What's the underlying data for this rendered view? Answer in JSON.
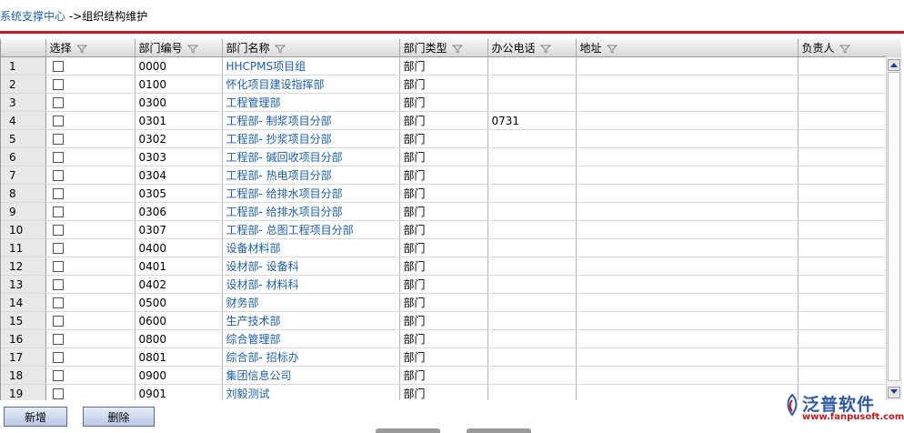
{
  "breadcrumb": {
    "root": "系统支撑中心",
    "separator": " ->",
    "current": "组织结构维护"
  },
  "columns": [
    "选择",
    "部门编号",
    "部门名称",
    "部门类型",
    "办公电话",
    "地址",
    "负责人"
  ],
  "rows": [
    {
      "n": "1",
      "code": "0000",
      "name": "HHCPMS项目组",
      "type": "部门",
      "phone": "",
      "addr": "",
      "owner": ""
    },
    {
      "n": "2",
      "code": "0100",
      "name": "怀化项目建设指挥部",
      "type": "部门",
      "phone": "",
      "addr": "",
      "owner": ""
    },
    {
      "n": "3",
      "code": "0300",
      "name": "工程管理部",
      "type": "部门",
      "phone": "",
      "addr": "",
      "owner": ""
    },
    {
      "n": "4",
      "code": "0301",
      "name": "工程部- 制浆项目分部",
      "type": "部门",
      "phone": "0731",
      "addr": "",
      "owner": ""
    },
    {
      "n": "5",
      "code": "0302",
      "name": "工程部- 抄浆项目分部",
      "type": "部门",
      "phone": "",
      "addr": "",
      "owner": ""
    },
    {
      "n": "6",
      "code": "0303",
      "name": "工程部- 碱回收项目分部",
      "type": "部门",
      "phone": "",
      "addr": "",
      "owner": ""
    },
    {
      "n": "7",
      "code": "0304",
      "name": "工程部- 热电项目分部",
      "type": "部门",
      "phone": "",
      "addr": "",
      "owner": ""
    },
    {
      "n": "8",
      "code": "0305",
      "name": "工程部- 给排水项目分部",
      "type": "部门",
      "phone": "",
      "addr": "",
      "owner": ""
    },
    {
      "n": "9",
      "code": "0306",
      "name": "工程部- 给排水项目分部",
      "type": "部门",
      "phone": "",
      "addr": "",
      "owner": ""
    },
    {
      "n": "10",
      "code": "0307",
      "name": "工程部- 总图工程项目分部",
      "type": "部门",
      "phone": "",
      "addr": "",
      "owner": ""
    },
    {
      "n": "11",
      "code": "0400",
      "name": "设备材料部",
      "type": "部门",
      "phone": "",
      "addr": "",
      "owner": ""
    },
    {
      "n": "12",
      "code": "0401",
      "name": "设材部- 设备科",
      "type": "部门",
      "phone": "",
      "addr": "",
      "owner": ""
    },
    {
      "n": "13",
      "code": "0402",
      "name": "设材部- 材料科",
      "type": "部门",
      "phone": "",
      "addr": "",
      "owner": ""
    },
    {
      "n": "14",
      "code": "0500",
      "name": "财务部",
      "type": "部门",
      "phone": "",
      "addr": "",
      "owner": ""
    },
    {
      "n": "15",
      "code": "0600",
      "name": "生产技术部",
      "type": "部门",
      "phone": "",
      "addr": "",
      "owner": ""
    },
    {
      "n": "16",
      "code": "0800",
      "name": "综合管理部",
      "type": "部门",
      "phone": "",
      "addr": "",
      "owner": ""
    },
    {
      "n": "17",
      "code": "0801",
      "name": "综合部- 招标办",
      "type": "部门",
      "phone": "",
      "addr": "",
      "owner": ""
    },
    {
      "n": "18",
      "code": "0900",
      "name": "集团信息公司",
      "type": "部门",
      "phone": "",
      "addr": "",
      "owner": ""
    },
    {
      "n": "19",
      "code": "0901",
      "name": "刘毅测试",
      "type": "部门",
      "phone": "",
      "addr": "",
      "owner": ""
    }
  ],
  "buttons": {
    "add": "新增",
    "delete": "删除"
  },
  "logo": {
    "brand": "泛普软件",
    "url": "www.fanpusoft.com"
  },
  "colors": {
    "link": "#1a5fae",
    "accent_line": "#c8171e"
  }
}
